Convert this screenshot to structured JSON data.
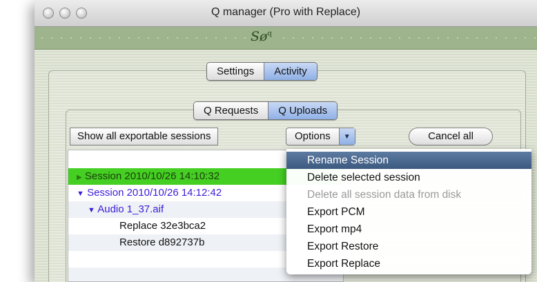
{
  "window": {
    "title": "Q manager (Pro with Replace)"
  },
  "logo": {
    "text": "Sø",
    "sup": "q"
  },
  "tabs": [
    {
      "label": "Settings",
      "selected": false
    },
    {
      "label": "Activity",
      "selected": true
    }
  ],
  "subtabs": [
    {
      "label": "Q Requests",
      "selected": false
    },
    {
      "label": "Q Uploads",
      "selected": true
    }
  ],
  "toolbar": {
    "show_all_label": "Show all exportable sessions",
    "options_label": "Options",
    "cancel_label": "Cancel all"
  },
  "sessions": [
    {
      "arrow": "▶",
      "label": "Session 2010/10/26 14:10:32",
      "highlighted": true
    },
    {
      "arrow": "▼",
      "label": "Session 2010/10/26 14:12:42",
      "highlighted": false
    }
  ],
  "file": {
    "arrow": "▼",
    "label": "Audio 1_37.aif"
  },
  "entries": [
    "Replace 32e3bca2",
    "Restore d892737b"
  ],
  "menu": {
    "items": [
      {
        "label": "Rename Session",
        "state": "active"
      },
      {
        "label": "Delete selected session",
        "state": "normal"
      },
      {
        "label": "Delete all session data from disk",
        "state": "disabled"
      },
      {
        "label": "Export PCM",
        "state": "normal"
      },
      {
        "label": "Export mp4",
        "state": "normal"
      },
      {
        "label": "Export Restore",
        "state": "normal"
      },
      {
        "label": "Export Replace",
        "state": "normal"
      }
    ]
  },
  "colors": {
    "accent_blue": "#8fb0e6",
    "session_text": "#3b1cd9",
    "highlight_green": "#44cf22",
    "menu_selected": "#3c5a80"
  }
}
